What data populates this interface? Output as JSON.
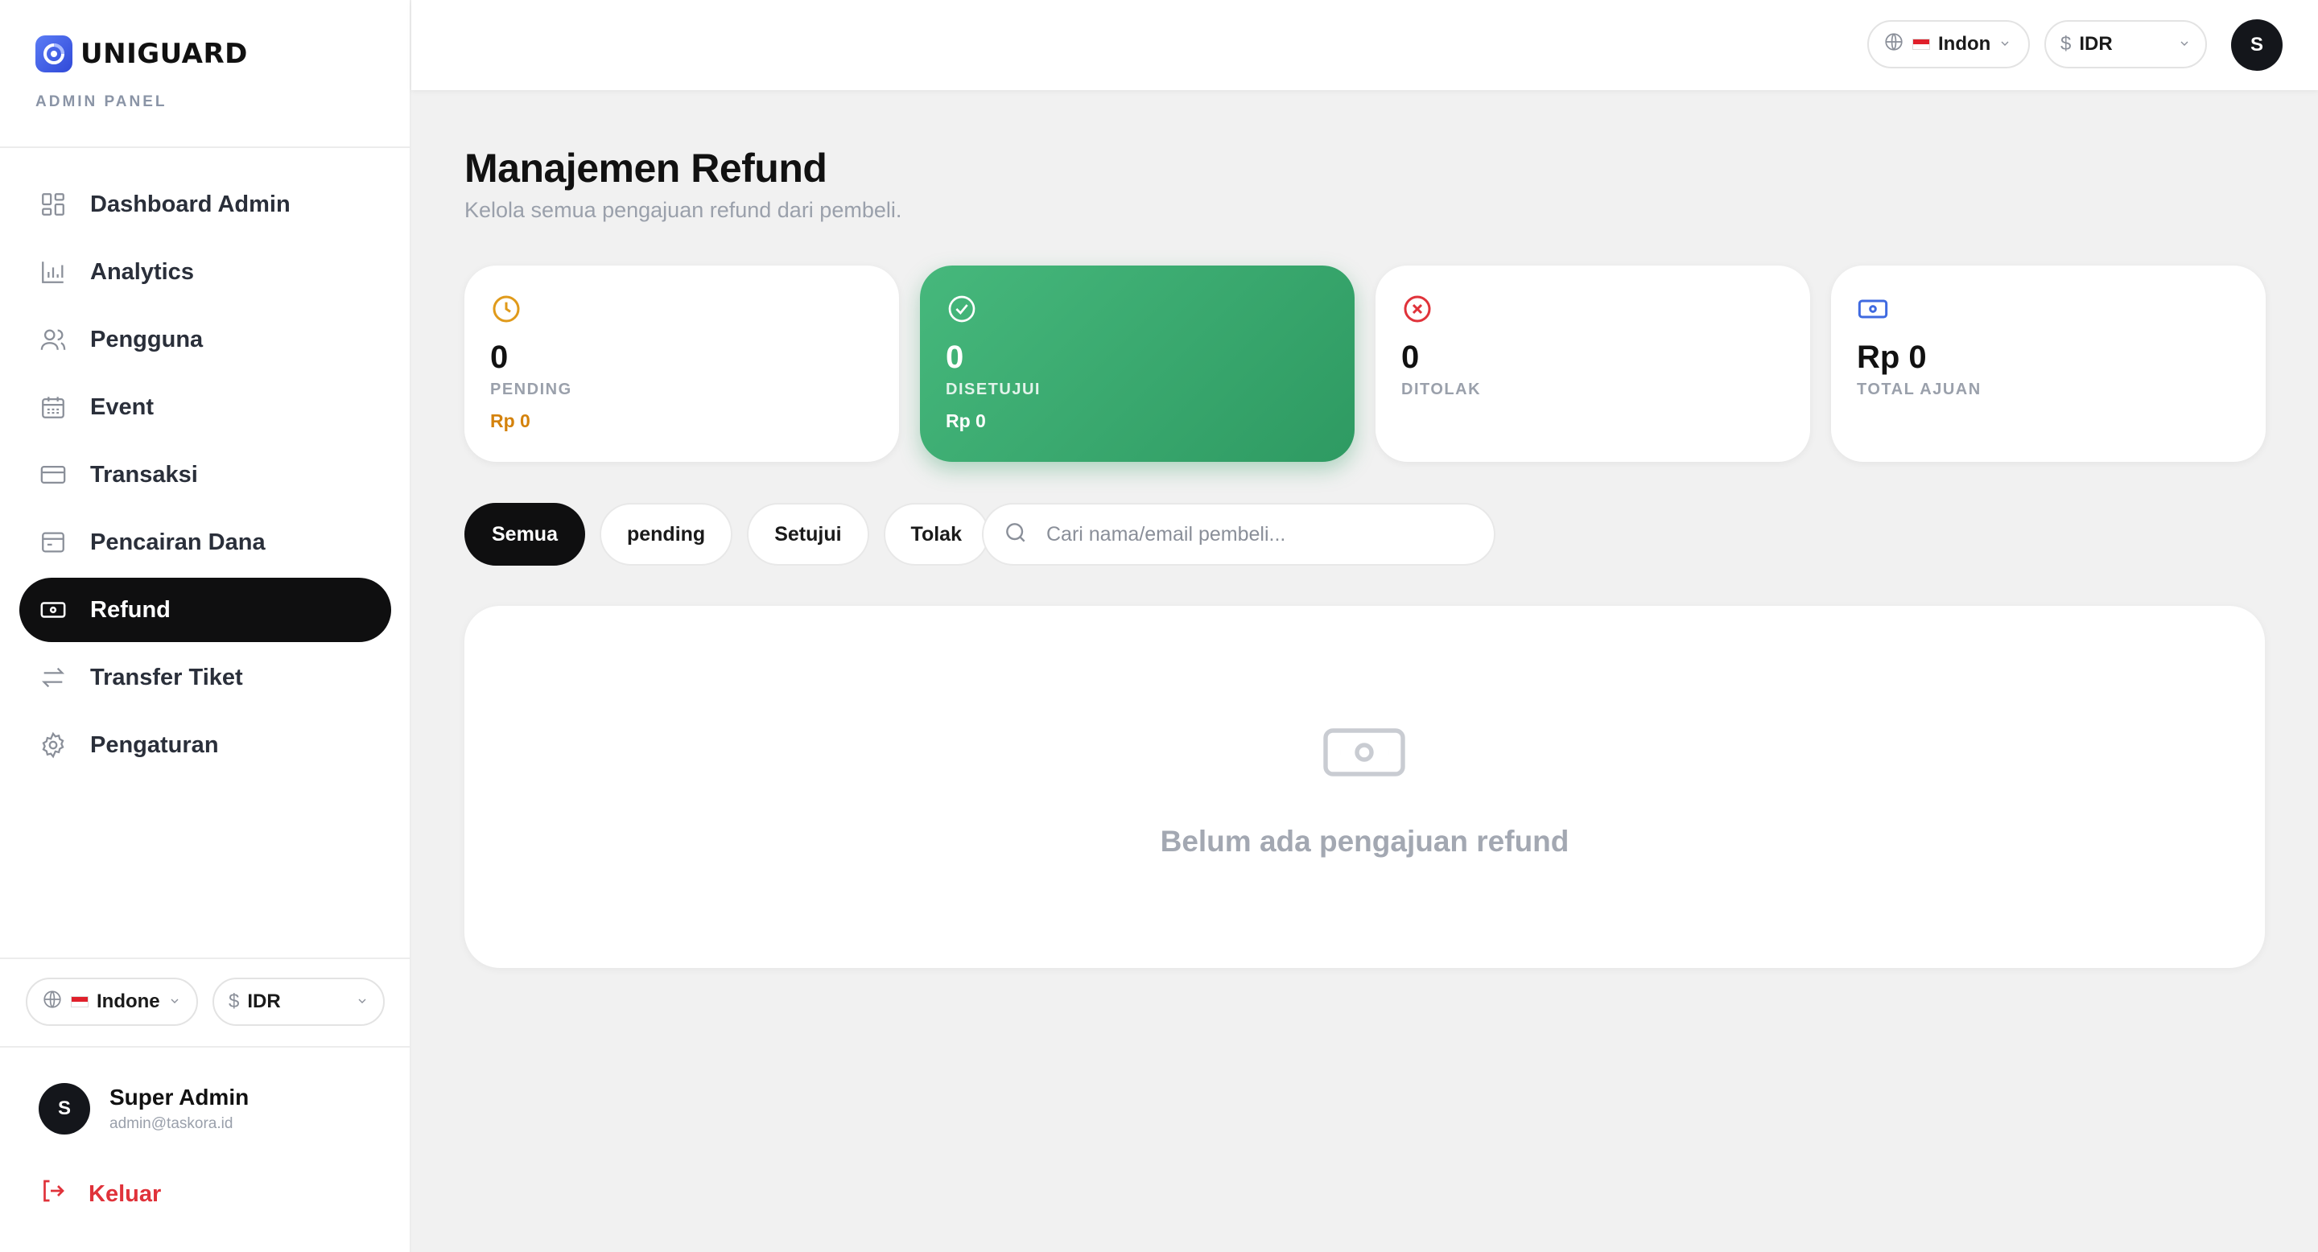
{
  "brand": {
    "name": "UNIGUARD",
    "subtitle": "ADMIN PANEL"
  },
  "sidebar": {
    "items": [
      {
        "label": "Dashboard Admin",
        "icon": "dashboard-icon"
      },
      {
        "label": "Analytics",
        "icon": "bar-chart-icon"
      },
      {
        "label": "Pengguna",
        "icon": "users-icon"
      },
      {
        "label": "Event",
        "icon": "calendar-icon"
      },
      {
        "label": "Transaksi",
        "icon": "credit-card-icon"
      },
      {
        "label": "Pencairan Dana",
        "icon": "wallet-icon"
      },
      {
        "label": "Refund",
        "icon": "banknote-icon",
        "active": true
      },
      {
        "label": "Transfer Tiket",
        "icon": "arrows-exchange-icon"
      },
      {
        "label": "Pengaturan",
        "icon": "gear-icon"
      }
    ],
    "language": "Indone",
    "currency": "IDR",
    "user": {
      "initial": "S",
      "name": "Super Admin",
      "email": "admin@taskora.id"
    },
    "logout_label": "Keluar"
  },
  "topbar": {
    "language": "Indon",
    "currency": "IDR",
    "avatar_initial": "S"
  },
  "page": {
    "title": "Manajemen Refund",
    "subtitle": "Kelola semua pengajuan refund dari pembeli."
  },
  "stats": [
    {
      "value": "0",
      "label": "PENDING",
      "amount": "Rp 0",
      "icon": "clock-icon",
      "color": "#e09a1a"
    },
    {
      "value": "0",
      "label": "DISETUJUI",
      "amount": "Rp 0",
      "icon": "check-circle-icon",
      "color": "#ffffff"
    },
    {
      "value": "0",
      "label": "DITOLAK",
      "amount": "",
      "icon": "x-circle-icon",
      "color": "#e0323a"
    },
    {
      "value": "Rp 0",
      "label": "TOTAL AJUAN",
      "amount": "",
      "icon": "banknote-icon",
      "color": "#3f6ae0"
    }
  ],
  "filters": {
    "tabs": [
      "Semua",
      "pending",
      "Setujui",
      "Tolak"
    ],
    "active": "Semua",
    "search_placeholder": "Cari nama/email pembeli..."
  },
  "empty_state": {
    "message": "Belum ada pengajuan refund",
    "icon": "banknote-icon"
  },
  "colors": {
    "accent_dark": "#0f0f10",
    "approved_green": "#3aa96f",
    "pending_orange": "#d4820c",
    "danger_red": "#e0323a"
  }
}
